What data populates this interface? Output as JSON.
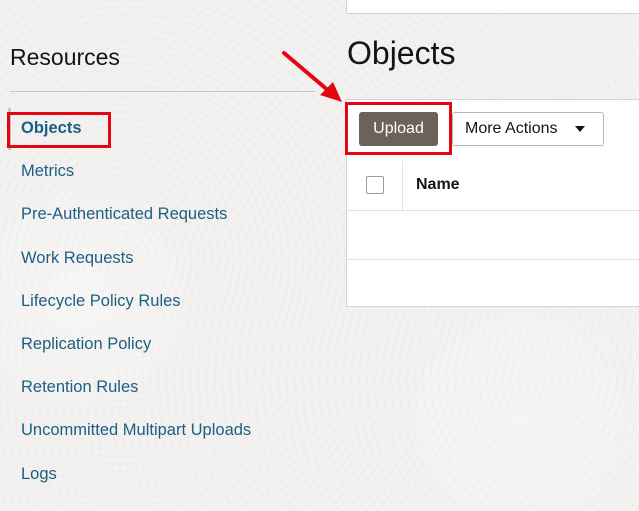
{
  "sidebar": {
    "title": "Resources",
    "items": [
      {
        "label": "Objects",
        "active": true
      },
      {
        "label": "Metrics",
        "active": false
      },
      {
        "label": "Pre-Authenticated Requests",
        "active": false
      },
      {
        "label": "Work Requests",
        "active": false
      },
      {
        "label": "Lifecycle Policy Rules",
        "active": false
      },
      {
        "label": "Replication Policy",
        "active": false
      },
      {
        "label": "Retention Rules",
        "active": false
      },
      {
        "label": "Uncommitted Multipart Uploads",
        "active": false
      },
      {
        "label": "Logs",
        "active": false
      }
    ]
  },
  "main": {
    "title": "Objects",
    "toolbar": {
      "upload_label": "Upload",
      "more_actions_label": "More Actions",
      "more_actions_icon": "caret-down-icon"
    },
    "table": {
      "columns": [
        "Name"
      ],
      "rows": []
    }
  },
  "annotations": {
    "highlight_color": "#e30613",
    "arrow_color": "#e30613"
  },
  "colors": {
    "link": "#1b5f83",
    "primary_button": "#6b625a",
    "background": "#f3f2f0"
  }
}
